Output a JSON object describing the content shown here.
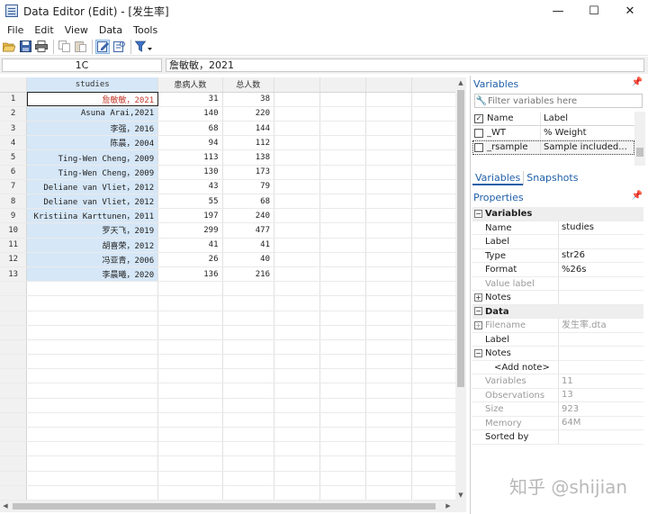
{
  "window": {
    "title": "Data Editor (Edit) - [发生率]",
    "minimize": "—",
    "maximize": "☐",
    "close": "✕"
  },
  "menu": [
    "File",
    "Edit",
    "View",
    "Data",
    "Tools"
  ],
  "editbar": {
    "cell_ref": "1C",
    "cell_value": "詹敏敏，2021"
  },
  "grid": {
    "columns": [
      "studies",
      "患病人数",
      "总人数"
    ],
    "rows": [
      [
        "詹敏敏，2021",
        "31",
        "38"
      ],
      [
        "Asuna Arai,2021",
        "140",
        "220"
      ],
      [
        "李强，2016",
        "68",
        "144"
      ],
      [
        "陈晨，2004",
        "94",
        "112"
      ],
      [
        "Ting-Wen Cheng，2009",
        "113",
        "138"
      ],
      [
        "Ting-Wen Cheng，2009",
        "130",
        "173"
      ],
      [
        "Deliane van Vliet，2012",
        "43",
        "79"
      ],
      [
        "Deliane van Vliet，2012",
        "55",
        "68"
      ],
      [
        "Kristiina Karttunen，2011",
        "197",
        "240"
      ],
      [
        "罗天飞，2019",
        "299",
        "477"
      ],
      [
        "胡喜荣，2012",
        "41",
        "41"
      ],
      [
        "冯亚青，2006",
        "26",
        "40"
      ],
      [
        "李晨曦，2020",
        "136",
        "216"
      ]
    ]
  },
  "variables_panel": {
    "title": "Variables",
    "filter_placeholder": "Filter variables here",
    "header_name": "Name",
    "header_label": "Label",
    "items": [
      {
        "name": "_WT",
        "label": "% Weight"
      },
      {
        "name": "_rsample",
        "label": "Sample included..."
      }
    ]
  },
  "tabs": [
    "Variables",
    "Snapshots"
  ],
  "properties": {
    "title": "Properties",
    "variables_section": "Variables",
    "var_rows": [
      {
        "key": "Name",
        "value": "studies"
      },
      {
        "key": "Label",
        "value": ""
      },
      {
        "key": "Type",
        "value": "str26"
      },
      {
        "key": "Format",
        "value": "%26s"
      },
      {
        "key": "Value label",
        "value": ""
      },
      {
        "key": "Notes",
        "value": ""
      }
    ],
    "data_section": "Data",
    "data_rows": [
      {
        "key": "Filename",
        "value": "发生率.dta"
      },
      {
        "key": "Label",
        "value": ""
      },
      {
        "key": "Notes",
        "value": ""
      },
      {
        "key": "<Add note>",
        "value": ""
      },
      {
        "key": "Variables",
        "value": "11"
      },
      {
        "key": "Observations",
        "value": "13"
      },
      {
        "key": "Size",
        "value": "923"
      },
      {
        "key": "Memory",
        "value": "64M"
      },
      {
        "key": "Sorted by",
        "value": ""
      }
    ]
  },
  "watermark": "知乎 @shijian"
}
